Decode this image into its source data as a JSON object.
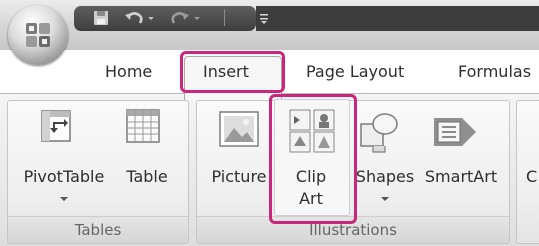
{
  "tabs": {
    "home": "Home",
    "insert": "Insert",
    "page_layout": "Page Layout",
    "formulas": "Formulas"
  },
  "groups": {
    "tables": {
      "label": "Tables",
      "buttons": {
        "pivot_table": "PivotTable",
        "table": "Table"
      }
    },
    "illustrations": {
      "label": "Illustrations",
      "buttons": {
        "picture": "Picture",
        "clip_art_line1": "Clip",
        "clip_art_line2": "Art",
        "shapes": "Shapes",
        "smart_art": "SmartArt"
      }
    },
    "charts": {
      "partial_label": "C"
    }
  },
  "quick_access": {
    "icons": [
      "save-icon",
      "undo-icon",
      "redo-icon",
      "customize-icon"
    ]
  },
  "highlight_color": "#c8277b"
}
